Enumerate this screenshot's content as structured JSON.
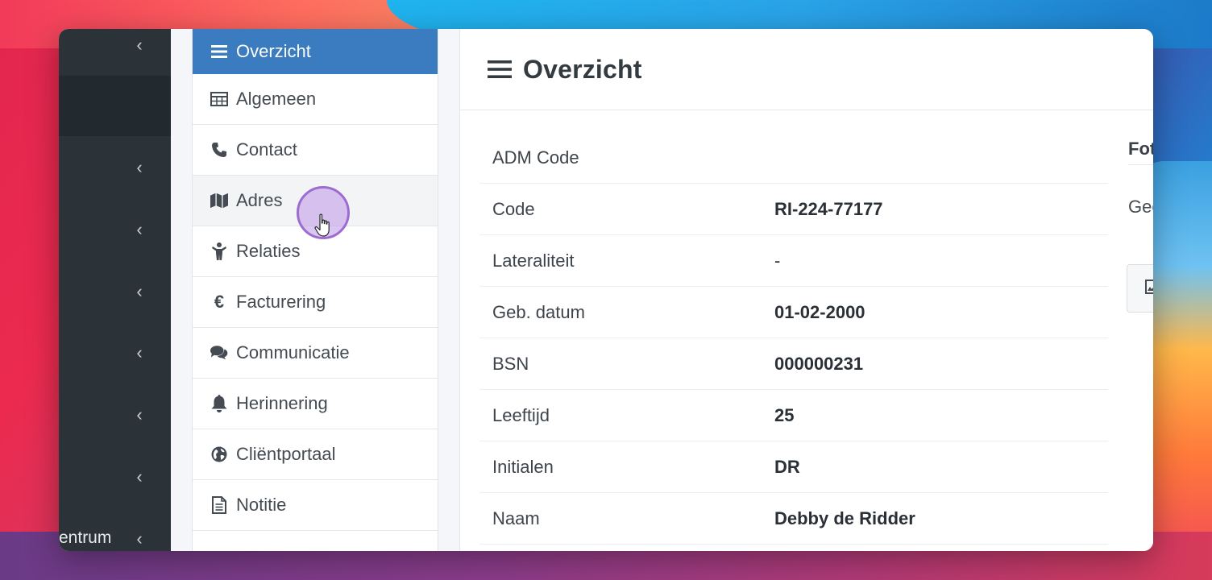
{
  "sidebar_dark": {
    "partial_label": "entrum"
  },
  "submenu": {
    "items": [
      {
        "label": "Overzicht",
        "icon": "bars-icon",
        "active": true
      },
      {
        "label": "Algemeen",
        "icon": "table-icon"
      },
      {
        "label": "Contact",
        "icon": "phone-icon"
      },
      {
        "label": "Adres",
        "icon": "map-icon"
      },
      {
        "label": "Relaties",
        "icon": "child-icon"
      },
      {
        "label": "Facturering",
        "icon": "euro-icon"
      },
      {
        "label": "Communicatie",
        "icon": "comments-icon"
      },
      {
        "label": "Herinnering",
        "icon": "bell-icon"
      },
      {
        "label": "Cliëntportaal",
        "icon": "globe-icon"
      },
      {
        "label": "Notitie",
        "icon": "file-text-icon"
      }
    ]
  },
  "main": {
    "title": "Overzicht",
    "rows": [
      {
        "label": "ADM Code",
        "value": ""
      },
      {
        "label": "Code",
        "value": "RI-224-77177"
      },
      {
        "label": "Lateraliteit",
        "value": "-"
      },
      {
        "label": "Geb. datum",
        "value": "01-02-2000"
      },
      {
        "label": "BSN",
        "value": "000000231"
      },
      {
        "label": "Leeftijd",
        "value": "25"
      },
      {
        "label": "Initialen",
        "value": "DR"
      },
      {
        "label": "Naam",
        "value": "Debby de Ridder"
      }
    ]
  },
  "right_panel": {
    "heading_partial": "Fot",
    "text_partial": "Gee"
  },
  "colors": {
    "active": "#3b7bbf",
    "dark_sidebar": "#2c3338"
  }
}
